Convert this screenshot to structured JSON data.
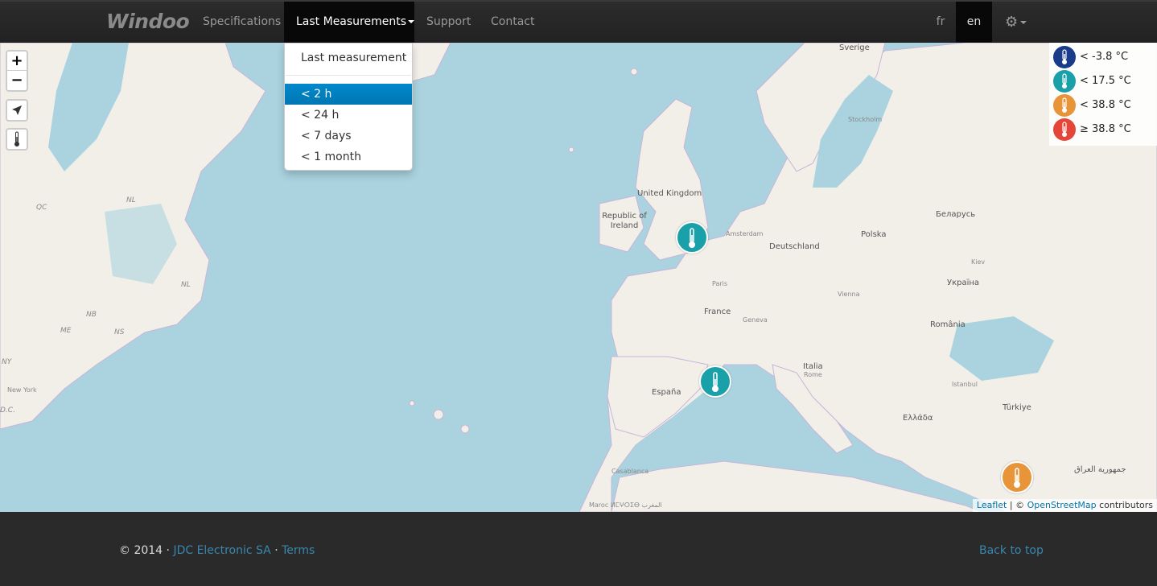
{
  "navbar": {
    "brand": "Windoo",
    "items": [
      {
        "label": "Specifications"
      },
      {
        "label": "Last Measurements"
      },
      {
        "label": "Support"
      },
      {
        "label": "Contact"
      }
    ],
    "languages": [
      "fr",
      "en"
    ],
    "active_language": "en",
    "settings_icon": "gear-icon"
  },
  "dropdown": {
    "header_item": "Last measurement",
    "items": [
      "< 2 h",
      "< 24 h",
      "< 7 days",
      "< 1 month"
    ],
    "selected": "< 2 h"
  },
  "map": {
    "controls": {
      "zoom_in": "+",
      "zoom_out": "−"
    },
    "labels": {
      "uk": "United Kingdom",
      "ireland": "Republic of Ireland",
      "france": "France",
      "germany": "Deutschland",
      "spain": "España",
      "italy": "Italia",
      "poland": "Polska",
      "belarus": "Беларусь",
      "ukraine": "Україна",
      "romania": "România",
      "greece": "Ελλάδα",
      "turkey": "Türkiye",
      "iraq": "جمهورية العراق",
      "sweden": "Sverige",
      "morocco": "Maroc ⵍⵎⵖⵔⵉⴱ المغرب",
      "newyork": "New York",
      "paris": "Paris",
      "amsterdam": "Amsterdam",
      "geneva": "Geneva",
      "rome": "Rome",
      "vienna": "Vienna",
      "stockholm": "Stockholm",
      "kiev": "Kiev",
      "istanbul": "Istanbul",
      "casablanca": "Casablanca",
      "qc": "QC",
      "nl": "NL",
      "nb": "NB",
      "ns": "NS",
      "me": "ME",
      "ny": "NY",
      "dc": "D.C."
    },
    "legend": [
      {
        "label": "< -3.8 °C",
        "color": "#1a3a8a"
      },
      {
        "label": "< 17.5 °C",
        "color": "#1aa0a8"
      },
      {
        "label": "< 38.8 °C",
        "color": "#e8953a"
      },
      {
        "label": "≥ 38.8 °C",
        "color": "#e5463a"
      }
    ],
    "markers": [
      {
        "name": "marker-uk",
        "color": "#1aa0a8"
      },
      {
        "name": "marker-spain",
        "color": "#1aa0a8"
      },
      {
        "name": "marker-east",
        "color": "#e8953a"
      }
    ],
    "attribution": {
      "leaflet": "Leaflet",
      "sep": " | © ",
      "osm": "OpenStreetMap",
      "suffix": " contributors"
    }
  },
  "footer": {
    "copyright": "© 2014 · ",
    "company": "JDC Electronic SA",
    "dot": " · ",
    "terms": "Terms",
    "back_to_top": "Back to top"
  }
}
